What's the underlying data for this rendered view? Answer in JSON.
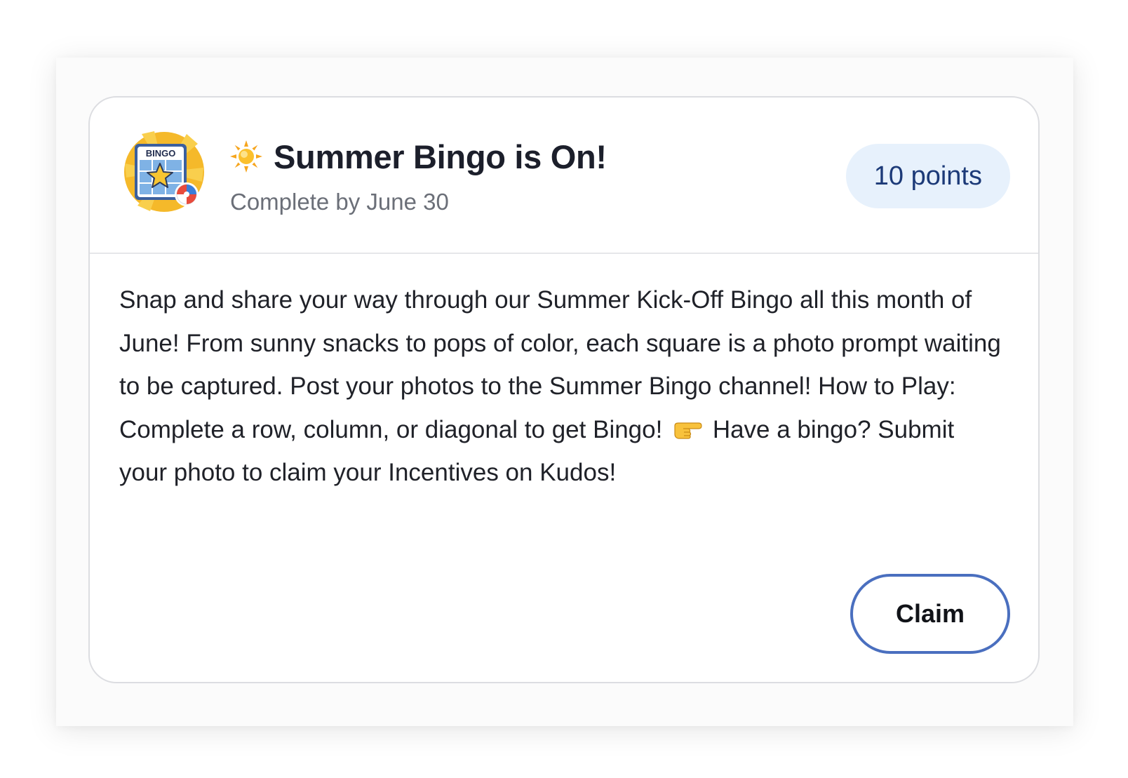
{
  "challenge": {
    "badge_icon": "bingo-badge-icon",
    "title_emoji_icon": "sun-icon",
    "title": "Summer Bingo is On!",
    "subtitle": "Complete by June 30",
    "points_label": "10 points",
    "description_part1": "Snap and share your way through our Summer Kick-Off Bingo all this month of June! From sunny snacks to pops of color, each square is a photo prompt waiting to be captured. Post your photos to the Summer Bingo channel! How to Play: Complete a row, column, or diagonal to get Bingo!",
    "description_emoji_icon": "pointing-hand-icon",
    "description_part2": "Have a bingo? Submit your photo to claim your Incentives on Kudos!",
    "claim_label": "Claim"
  },
  "badge": {
    "label": "BINGO"
  },
  "colors": {
    "points_background": "#e7f1fc",
    "points_text": "#1c3a78",
    "claim_border": "#4a6fbf",
    "card_border": "#dcdde1"
  }
}
